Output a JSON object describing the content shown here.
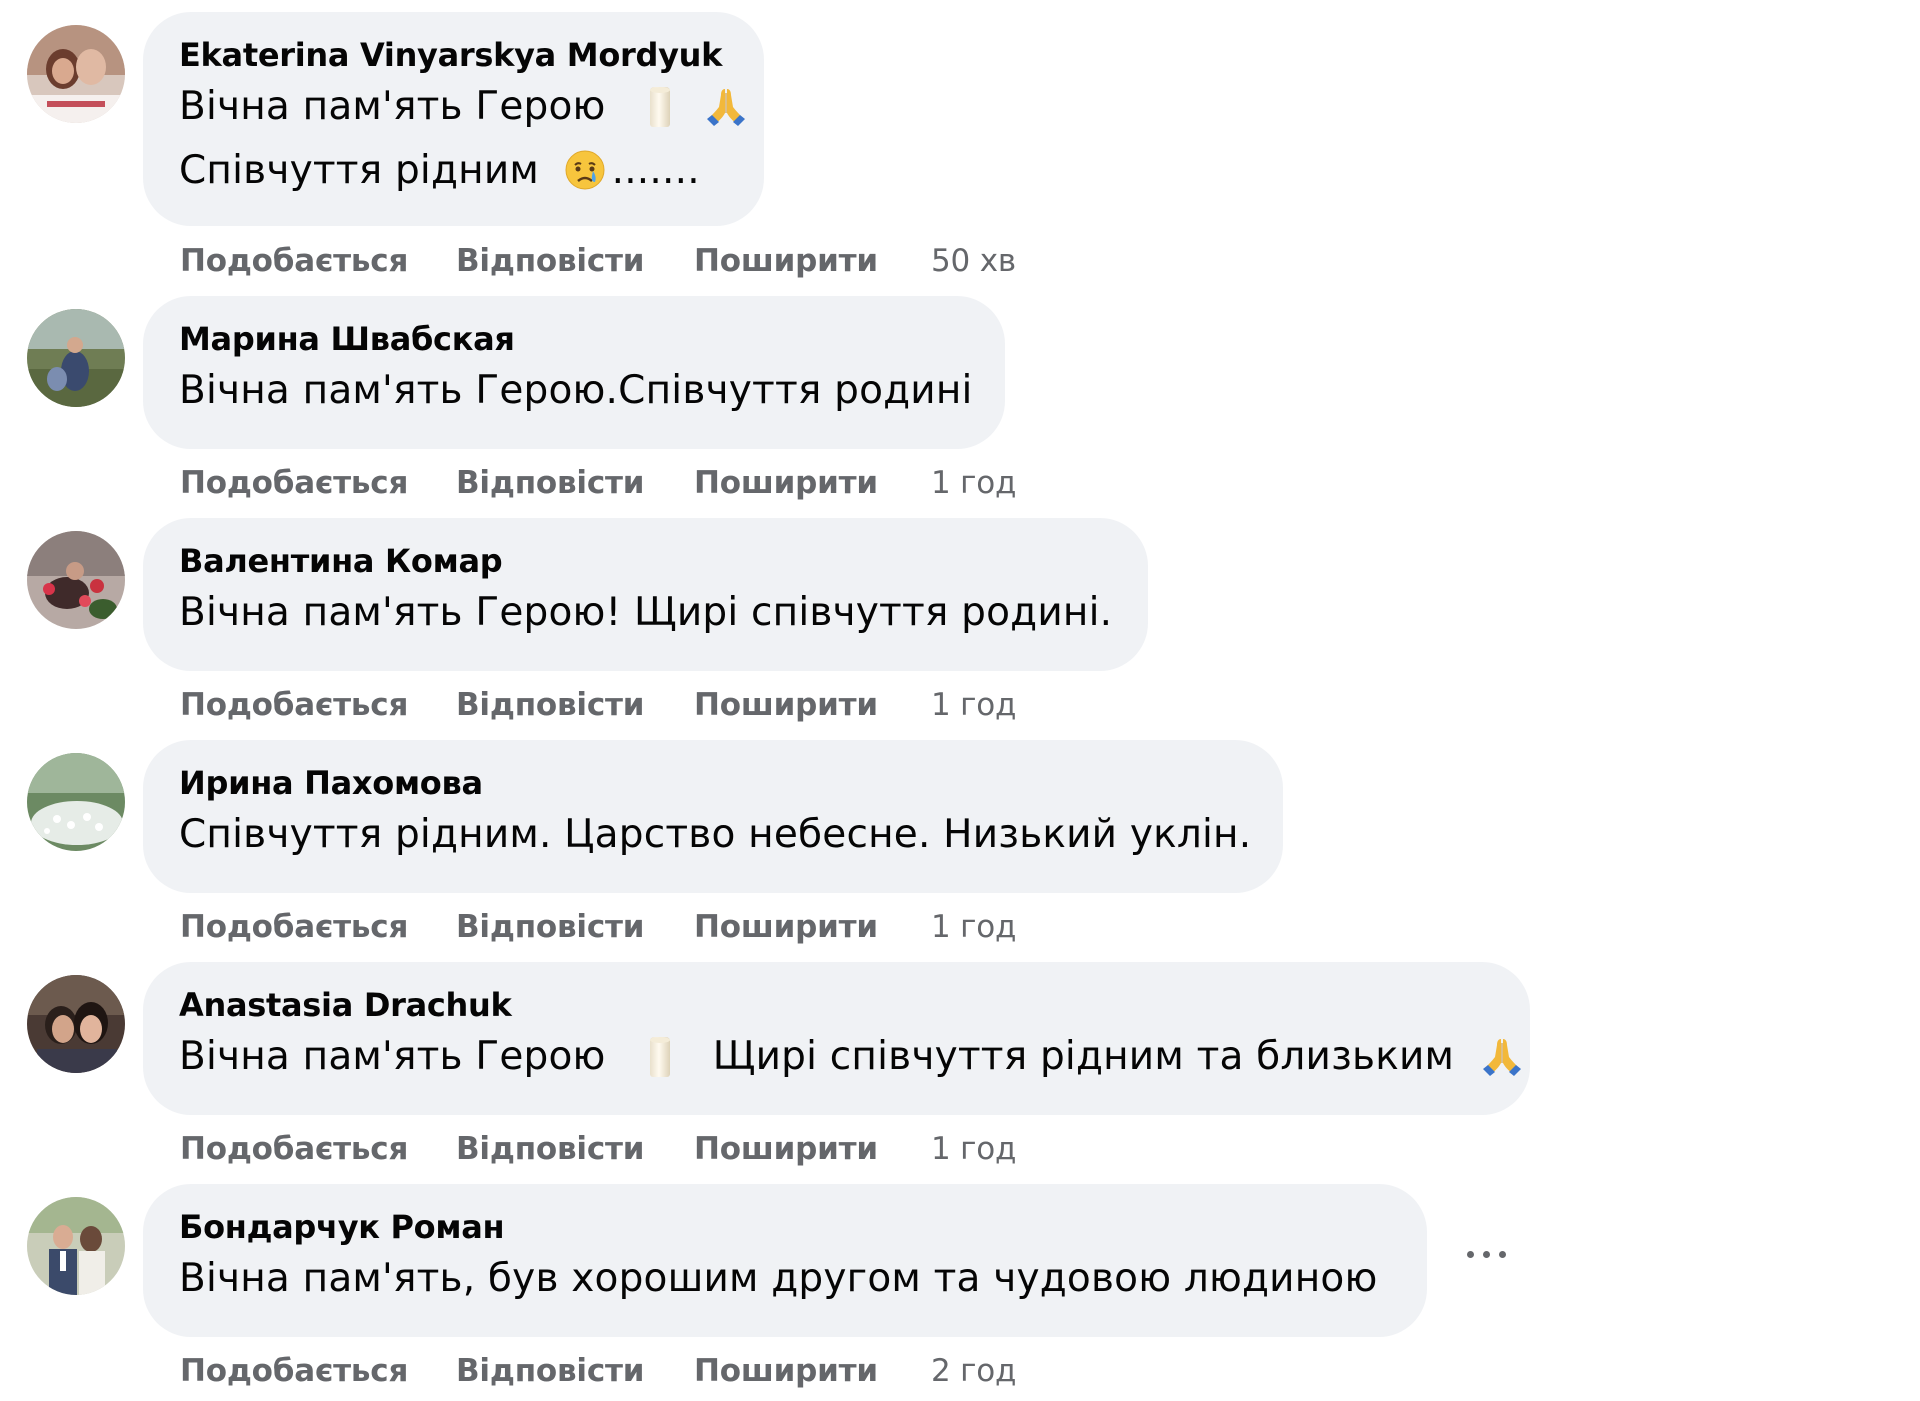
{
  "actions": {
    "like_label": "Подобається",
    "reply_label": "Відповісти",
    "share_label": "Поширити"
  },
  "comments": [
    {
      "author": "Ekaterina Vinyarskya Mordyuk",
      "lines": [
        "Вічна пам'ять Герою",
        "Співчуття рідним",
        "......."
      ],
      "emoji": [
        "candle",
        "folded-hands",
        "crying-face"
      ],
      "time": "50 хв"
    },
    {
      "author": "Марина Швабская",
      "lines": [
        "Вічна пам'ять Герою.Співчуття родині"
      ],
      "time": "1 год"
    },
    {
      "author": "Валентина Комар",
      "lines": [
        "Вічна пам'ять Герою! Щирі співчуття родині."
      ],
      "time": "1 год"
    },
    {
      "author": "Ирина Пахомова",
      "lines": [
        "Співчуття рідним. Царство небесне. Низький уклін."
      ],
      "time": "1 год"
    },
    {
      "author": "Anastasia Drachuk",
      "lines": [
        "Вічна пам'ять Герою",
        "Щирі співчуття рідним та близьким"
      ],
      "emoji": [
        "candle",
        "folded-hands"
      ],
      "time": "1 год"
    },
    {
      "author": "Бондарчук Роман",
      "lines": [
        "Вічна пам'ять, був хорошим другом та чудовою людиною"
      ],
      "time": "2 год",
      "more_icon": "more-options-icon"
    }
  ],
  "colors": {
    "bubble_background": "#f0f2f5",
    "author_text": "#050505",
    "meta_text": "#65676b"
  }
}
